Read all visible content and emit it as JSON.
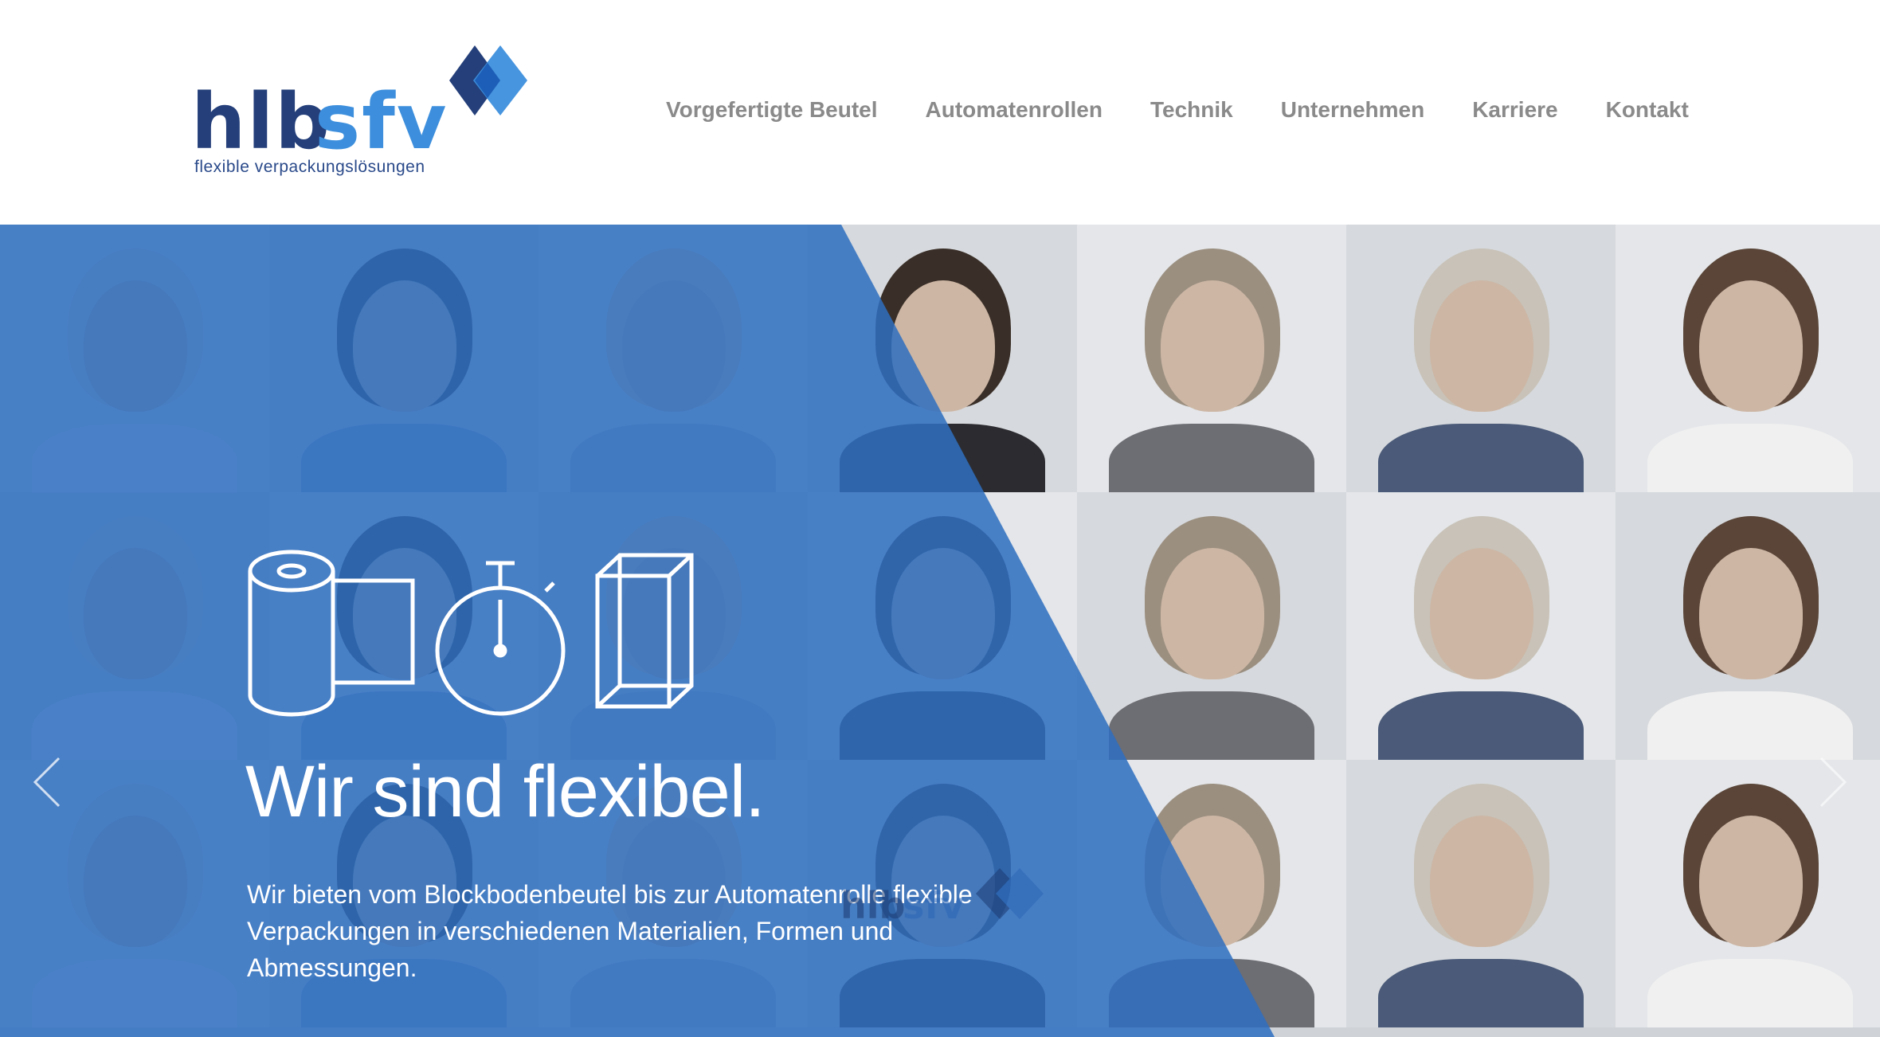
{
  "header": {
    "logo": {
      "part1": "hlb",
      "part2": "sfv",
      "tagline": "flexible verpackungslösungen"
    },
    "nav": [
      {
        "label": "Vorgefertigte Beutel"
      },
      {
        "label": "Automatenrollen"
      },
      {
        "label": "Technik"
      },
      {
        "label": "Unternehmen"
      },
      {
        "label": "Karriere"
      },
      {
        "label": "Kontakt"
      }
    ]
  },
  "hero": {
    "title": "Wir sind flexibel.",
    "text": "Wir bieten vom Blockbodenbeutel bis zur Automatenrolle flexible Verpackungen in verschiedenen Materialien, Formen und Abmessungen.",
    "icons": [
      "roll-icon",
      "stopwatch-icon",
      "box-icon"
    ],
    "watermark": {
      "part1": "hlb",
      "part2": "sfv"
    }
  },
  "colors": {
    "brand_dark": "#243f7a",
    "brand_light": "#3d8fdd",
    "overlay_blue": "#2f6fc0",
    "nav_text": "#8a8a8a"
  }
}
